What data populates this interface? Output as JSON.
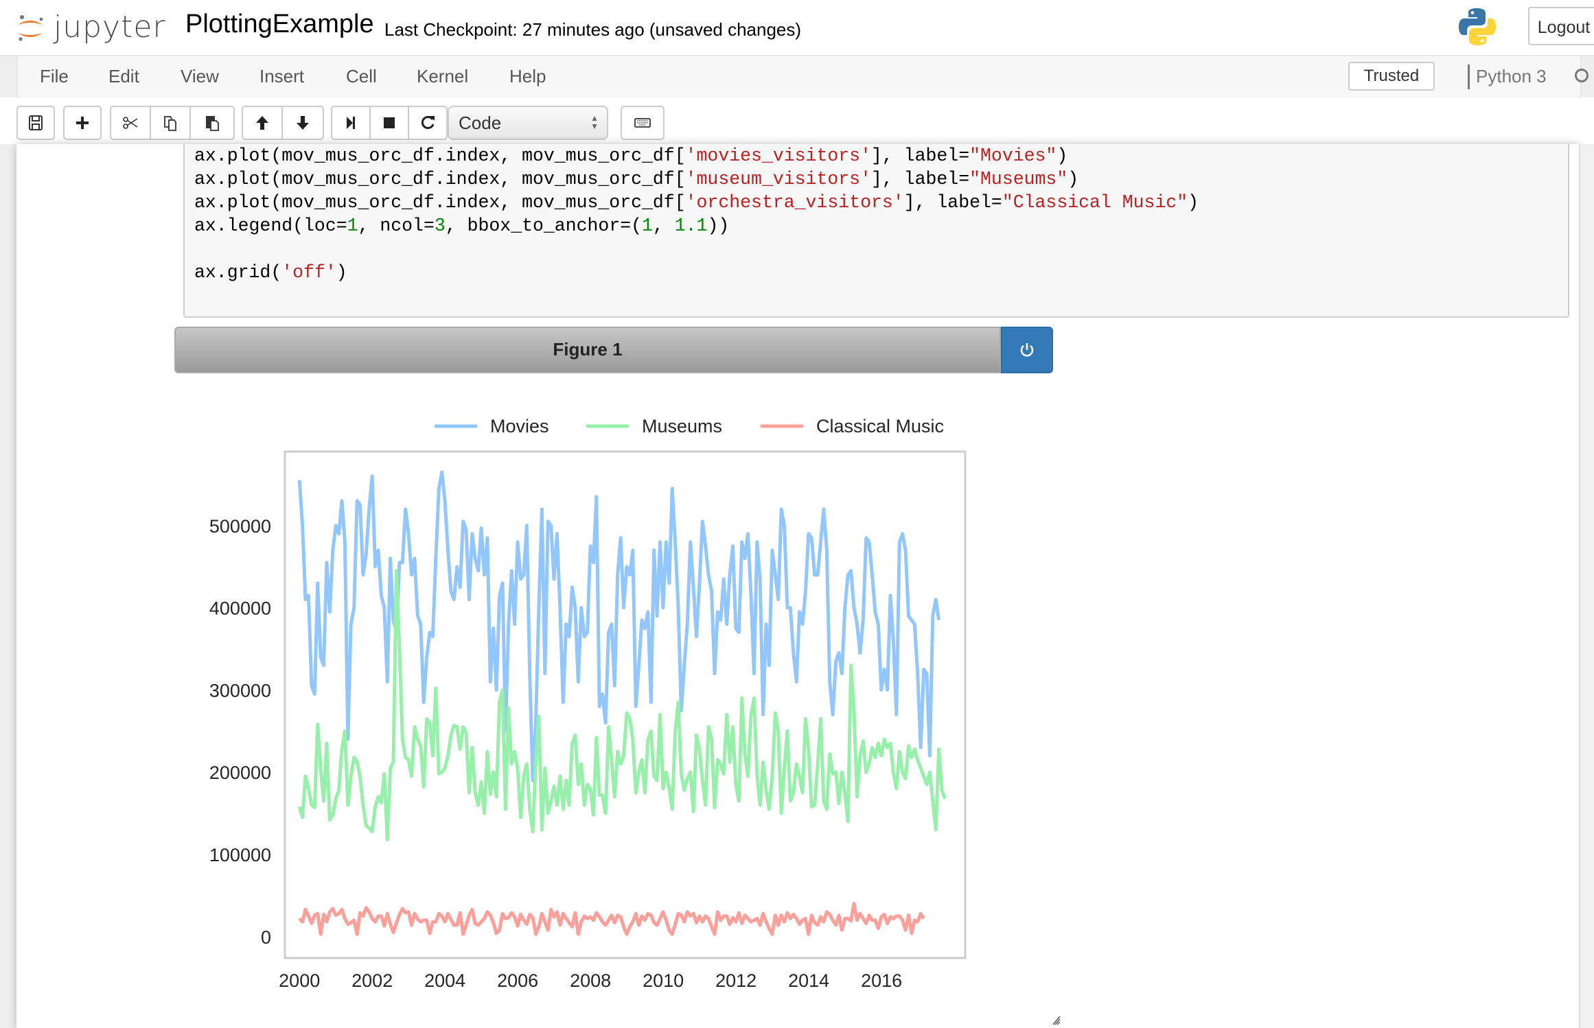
{
  "header": {
    "logo_text": "jupyter",
    "notebook_name": "PlottingExample",
    "checkpoint": "Last Checkpoint: 27 minutes ago (unsaved changes)",
    "logout_label": "Logout",
    "python_logo_icon": "python-logo-icon"
  },
  "menubar": {
    "items": [
      "File",
      "Edit",
      "View",
      "Insert",
      "Cell",
      "Kernel",
      "Help"
    ],
    "trusted_label": "Trusted",
    "kernel_name": "Python 3",
    "kernel_status": "idle"
  },
  "toolbar": {
    "buttons": [
      {
        "name": "save",
        "icon": "floppy-disk-icon"
      },
      {
        "name": "insert-cell-below",
        "icon": "plus-icon"
      },
      {
        "name": "cut",
        "icon": "scissors-icon"
      },
      {
        "name": "copy",
        "icon": "copy-icon"
      },
      {
        "name": "paste",
        "icon": "paste-icon"
      },
      {
        "name": "move-up",
        "icon": "arrow-up-icon"
      },
      {
        "name": "move-down",
        "icon": "arrow-down-icon"
      },
      {
        "name": "run",
        "icon": "step-forward-icon"
      },
      {
        "name": "interrupt",
        "icon": "stop-icon"
      },
      {
        "name": "restart",
        "icon": "refresh-icon"
      },
      {
        "name": "command-palette",
        "icon": "keyboard-icon"
      }
    ],
    "cell_type": "Code"
  },
  "code_cell": {
    "lines": [
      [
        {
          "t": "ax.plot(mov_mus_orc_df.index, mov_mus_orc_df["
        },
        {
          "t": "'movies_visitors'",
          "c": "str"
        },
        {
          "t": "], label="
        },
        {
          "t": "\"Movies\"",
          "c": "str"
        },
        {
          "t": ")"
        }
      ],
      [
        {
          "t": "ax.plot(mov_mus_orc_df.index, mov_mus_orc_df["
        },
        {
          "t": "'museum_visitors'",
          "c": "str"
        },
        {
          "t": "], label="
        },
        {
          "t": "\"Museums\"",
          "c": "str"
        },
        {
          "t": ")"
        }
      ],
      [
        {
          "t": "ax.plot(mov_mus_orc_df.index, mov_mus_orc_df["
        },
        {
          "t": "'orchestra_visitors'",
          "c": "str"
        },
        {
          "t": "], label="
        },
        {
          "t": "\"Classical Music\"",
          "c": "str"
        },
        {
          "t": ")"
        }
      ],
      [
        {
          "t": "ax.legend(loc="
        },
        {
          "t": "1",
          "c": "num"
        },
        {
          "t": ", ncol="
        },
        {
          "t": "3",
          "c": "num"
        },
        {
          "t": ", bbox_to_anchor=("
        },
        {
          "t": "1",
          "c": "num"
        },
        {
          "t": ", "
        },
        {
          "t": "1.1",
          "c": "num"
        },
        {
          "t": "))"
        }
      ],
      [
        {
          "t": ""
        }
      ],
      [
        {
          "t": "ax.grid("
        },
        {
          "t": "'off'",
          "c": "str"
        },
        {
          "t": ")"
        }
      ]
    ]
  },
  "figure": {
    "title": "Figure 1",
    "close_icon": "power-icon"
  },
  "chart_data": {
    "type": "line",
    "title": "",
    "xlabel": "",
    "ylabel": "",
    "x_start": 2000.0,
    "x_step_years": 0.0833,
    "xlim": [
      1999.6,
      2018.3
    ],
    "ylim": [
      -26000,
      590000
    ],
    "xticks": [
      2000,
      2002,
      2004,
      2006,
      2008,
      2010,
      2012,
      2014,
      2016
    ],
    "yticks": [
      0,
      100000,
      200000,
      300000,
      400000,
      500000
    ],
    "ytick_labels": [
      "0",
      "100000",
      "200000",
      "300000",
      "400000",
      "500000"
    ],
    "grid": false,
    "legend": {
      "placement": "top-right-outside",
      "ncol": 3
    },
    "series": [
      {
        "name": "Movies",
        "color": "#92c6ff",
        "values": [
          555000,
          500000,
          410000,
          415000,
          305000,
          295000,
          430000,
          340000,
          330000,
          455000,
          395000,
          470000,
          500000,
          490000,
          530000,
          480000,
          240000,
          380000,
          400000,
          530000,
          525000,
          440000,
          465000,
          520000,
          560000,
          450000,
          470000,
          415000,
          400000,
          310000,
          460000,
          385000,
          370000,
          455000,
          455000,
          520000,
          490000,
          440000,
          460000,
          390000,
          380000,
          285000,
          340000,
          370000,
          365000,
          460000,
          545000,
          565000,
          530000,
          470000,
          420000,
          410000,
          450000,
          425000,
          505000,
          495000,
          410000,
          490000,
          460000,
          445000,
          497000,
          440000,
          485000,
          310000,
          375000,
          300000,
          415000,
          430000,
          250000,
          380000,
          445000,
          380000,
          480000,
          435000,
          440000,
          500000,
          320000,
          190000,
          260000,
          400000,
          520000,
          320000,
          505000,
          500000,
          435000,
          490000,
          400000,
          285000,
          380000,
          365000,
          425000,
          400000,
          310000,
          400000,
          365000,
          370000,
          475000,
          455000,
          535000,
          280000,
          295000,
          260000,
          370000,
          380000,
          305000,
          440000,
          485000,
          400000,
          450000,
          440000,
          470000,
          280000,
          330000,
          385000,
          375000,
          395000,
          285000,
          470000,
          390000,
          480000,
          400000,
          480000,
          430000,
          545000,
          480000,
          400000,
          275000,
          330000,
          380000,
          480000,
          425000,
          365000,
          430000,
          505000,
          475000,
          440000,
          420000,
          320000,
          395000,
          385000,
          435000,
          380000,
          440000,
          475000,
          375000,
          370000,
          480000,
          460000,
          490000,
          415000,
          320000,
          480000,
          435000,
          270000,
          380000,
          330000,
          470000,
          440000,
          410000,
          520000,
          500000,
          400000,
          400000,
          345000,
          310000,
          395000,
          380000,
          420000,
          490000,
          485000,
          440000,
          440000,
          480000,
          520000,
          470000,
          310000,
          270000,
          335000,
          345000,
          320000,
          400000,
          440000,
          445000,
          400000,
          380000,
          345000,
          385000,
          485000,
          480000,
          440000,
          395000,
          380000,
          300000,
          325000,
          300000,
          415000,
          360000,
          270000,
          480000,
          490000,
          470000,
          390000,
          385000,
          380000,
          320000,
          230000,
          325000,
          320000,
          220000,
          390000,
          410000,
          385000
        ]
      },
      {
        "name": "Museums",
        "color": "#97f0aa",
        "values": [
          158000,
          145000,
          195000,
          180000,
          160000,
          157000,
          258000,
          205000,
          165000,
          235000,
          142000,
          148000,
          168000,
          178000,
          228000,
          250000,
          160000,
          195000,
          218000,
          213000,
          195000,
          160000,
          135000,
          132000,
          128000,
          158000,
          170000,
          163000,
          198000,
          118000,
          205000,
          213000,
          445000,
          350000,
          240000,
          218000,
          215000,
          195000,
          255000,
          240000,
          232000,
          182000,
          265000,
          260000,
          220000,
          302000,
          198000,
          200000,
          205000,
          220000,
          245000,
          257000,
          255000,
          228000,
          255000,
          248000,
          175000,
          230000,
          175000,
          160000,
          188000,
          150000,
          225000,
          173000,
          200000,
          170000,
          285000,
          300000,
          155000,
          278000,
          210000,
          225000,
          205000,
          145000,
          195000,
          210000,
          155000,
          128000,
          212000,
          268000,
          130000,
          205000,
          150000,
          165000,
          183000,
          160000,
          195000,
          155000,
          190000,
          160000,
          235000,
          245000,
          185000,
          210000,
          160000,
          185000,
          180000,
          148000,
          242000,
          172000,
          172000,
          150000,
          255000,
          215000,
          170000,
          225000,
          210000,
          220000,
          272000,
          265000,
          240000,
          175000,
          200000,
          215000,
          175000,
          240000,
          250000,
          195000,
          190000,
          270000,
          180000,
          200000,
          180000,
          155000,
          250000,
          285000,
          198000,
          178000,
          192000,
          200000,
          152000,
          245000,
          228000,
          190000,
          160000,
          255000,
          240000,
          157000,
          215000,
          210000,
          198000,
          270000,
          212000,
          255000,
          185000,
          165000,
          290000,
          222000,
          195000,
          270000,
          290000,
          197000,
          160000,
          212000,
          178000,
          155000,
          195000,
          272000,
          250000,
          150000,
          205000,
          250000,
          165000,
          175000,
          210000,
          195000,
          175000,
          265000,
          228000,
          158000,
          160000,
          210000,
          265000,
          165000,
          155000,
          222000,
          198000,
          200000,
          162000,
          200000,
          175000,
          140000,
          330000,
          275000,
          170000,
          220000,
          238000,
          200000,
          210000,
          230000,
          218000,
          235000,
          220000,
          240000,
          230000,
          235000,
          200000,
          180000,
          225000,
          200000,
          192000,
          232000,
          218000,
          228000,
          215000,
          205000,
          195000,
          185000,
          200000,
          165000,
          130000,
          228000,
          178000,
          168000
        ]
      },
      {
        "name": "Classical Music",
        "color": "#ff9f9a",
        "values": [
          22000,
          18000,
          33000,
          25000,
          16000,
          26000,
          28000,
          3000,
          27000,
          18000,
          30000,
          34000,
          26000,
          28000,
          33000,
          22000,
          15000,
          17000,
          20000,
          3000,
          29000,
          25000,
          35000,
          30000,
          22000,
          18000,
          25000,
          25000,
          13000,
          28000,
          15000,
          5000,
          17000,
          27000,
          34000,
          29000,
          30000,
          14000,
          28000,
          21000,
          18000,
          20000,
          20000,
          4000,
          18000,
          18000,
          28000,
          25000,
          18000,
          28000,
          21000,
          14000,
          14000,
          29000,
          3000,
          14000,
          26000,
          33000,
          16000,
          14000,
          18000,
          22000,
          30000,
          26000,
          17000,
          4000,
          8000,
          28000,
          22000,
          23000,
          29000,
          24000,
          13000,
          27000,
          20000,
          15000,
          27000,
          23000,
          3000,
          12000,
          28000,
          18000,
          8000,
          33000,
          24000,
          30000,
          14000,
          28000,
          22000,
          17000,
          12000,
          29000,
          3000,
          18000,
          25000,
          22000,
          24000,
          20000,
          29000,
          24000,
          18000,
          14000,
          20000,
          26000,
          17000,
          26000,
          24000,
          12000,
          3000,
          12000,
          18000,
          28000,
          14000,
          25000,
          20000,
          28000,
          26000,
          17000,
          14000,
          22000,
          30000,
          20000,
          8000,
          3000,
          15000,
          28000,
          26000,
          18000,
          30000,
          25000,
          28000,
          17000,
          25000,
          18000,
          25000,
          22000,
          12000,
          3000,
          30000,
          20000,
          25000,
          25000,
          15000,
          23000,
          18000,
          29000,
          16000,
          26000,
          22000,
          18000,
          20000,
          22000,
          14000,
          28000,
          18000,
          10000,
          3000,
          26000,
          14000,
          26000,
          18000,
          29000,
          22000,
          27000,
          22000,
          15000,
          20000,
          22000,
          3000,
          26000,
          17000,
          14000,
          24000,
          18000,
          30000,
          27000,
          20000,
          14000,
          26000,
          8000,
          22000,
          22000,
          19000,
          40000,
          20000,
          28000,
          22000,
          16000,
          26000,
          20000,
          20000,
          10000,
          24000,
          27000,
          16000,
          24000,
          22000,
          25000,
          25000,
          20000,
          8000,
          26000,
          4000,
          20000,
          18000,
          28000,
          22000
        ]
      }
    ]
  }
}
